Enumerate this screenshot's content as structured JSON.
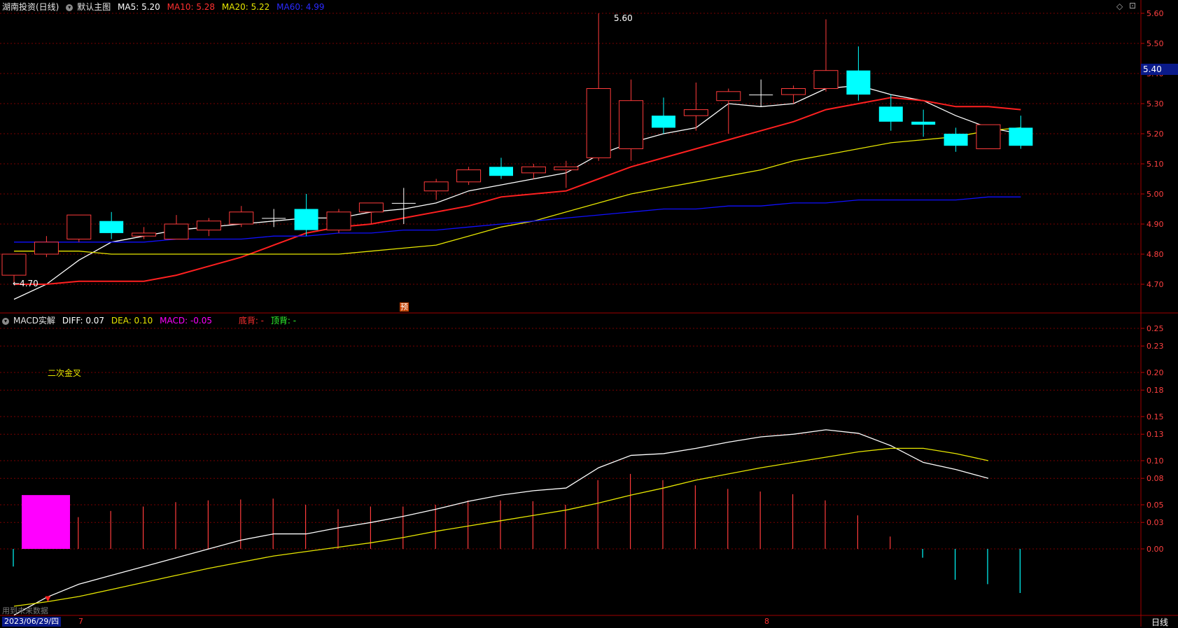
{
  "price_header": {
    "stock": "湖南投资(日线)",
    "main_label": "默认主图",
    "ma5": "MA5: 5.20",
    "ma10": "MA10: 5.28",
    "ma20": "MA20: 5.22",
    "ma60": "MA60: 4.99"
  },
  "macd_header": {
    "name": "MACD实解",
    "diff": "DIFF: 0.07",
    "dea": "DEA: 0.10",
    "macd": "MACD: -0.05",
    "bottom_div": "底背: -",
    "top_div": "顶背: -"
  },
  "annotations": {
    "high": "5.60",
    "low": "←4.70",
    "golden_cross": "二次金叉",
    "forecast": "预",
    "future_data": "用到未来数据"
  },
  "current_price": "5.40",
  "footer": {
    "date": "2023/06/29/四",
    "month7": "7",
    "month8": "8",
    "period": "日线"
  },
  "colors": {
    "up": "#ff3b3b",
    "down": "#00ffff",
    "ma5": "#ffffff",
    "ma10": "#ff2020",
    "ma20": "#e6e600",
    "ma60": "#1010ff",
    "macd_block": "#ff00ff",
    "grid": "#7a0000"
  },
  "chart_data": [
    {
      "type": "candlestick",
      "ylim": [
        4.62,
        5.62
      ],
      "yticks": [
        "5.60",
        "5.50",
        "5.40",
        "5.30",
        "5.20",
        "5.10",
        "5.00",
        "4.90",
        "4.80",
        "4.70"
      ],
      "candles": [
        {
          "o": 4.73,
          "h": 4.79,
          "l": 4.7,
          "c": 4.8
        },
        {
          "o": 4.8,
          "h": 4.86,
          "l": 4.79,
          "c": 4.84
        },
        {
          "o": 4.85,
          "h": 4.93,
          "l": 4.84,
          "c": 4.93
        },
        {
          "o": 4.91,
          "h": 4.94,
          "l": 4.85,
          "c": 4.87
        },
        {
          "o": 4.86,
          "h": 4.89,
          "l": 4.85,
          "c": 4.87
        },
        {
          "o": 4.85,
          "h": 4.93,
          "l": 4.85,
          "c": 4.9
        },
        {
          "o": 4.88,
          "h": 4.92,
          "l": 4.86,
          "c": 4.91
        },
        {
          "o": 4.9,
          "h": 4.96,
          "l": 4.89,
          "c": 4.94
        },
        {
          "o": 4.92,
          "h": 4.95,
          "l": 4.89,
          "c": 4.92
        },
        {
          "o": 4.95,
          "h": 5.0,
          "l": 4.86,
          "c": 4.88
        },
        {
          "o": 4.88,
          "h": 4.95,
          "l": 4.87,
          "c": 4.94
        },
        {
          "o": 4.94,
          "h": 4.97,
          "l": 4.9,
          "c": 4.97
        },
        {
          "o": 4.97,
          "h": 5.02,
          "l": 4.9,
          "c": 4.97
        },
        {
          "o": 5.01,
          "h": 5.05,
          "l": 4.98,
          "c": 5.04
        },
        {
          "o": 5.04,
          "h": 5.09,
          "l": 5.03,
          "c": 5.08
        },
        {
          "o": 5.09,
          "h": 5.12,
          "l": 5.05,
          "c": 5.06
        },
        {
          "o": 5.07,
          "h": 5.1,
          "l": 5.05,
          "c": 5.09
        },
        {
          "o": 5.08,
          "h": 5.11,
          "l": 5.02,
          "c": 5.09
        },
        {
          "o": 5.12,
          "h": 5.6,
          "l": 5.11,
          "c": 5.35
        },
        {
          "o": 5.15,
          "h": 5.38,
          "l": 5.11,
          "c": 5.31
        },
        {
          "o": 5.26,
          "h": 5.32,
          "l": 5.2,
          "c": 5.22
        },
        {
          "o": 5.26,
          "h": 5.37,
          "l": 5.21,
          "c": 5.28
        },
        {
          "o": 5.31,
          "h": 5.35,
          "l": 5.2,
          "c": 5.34
        },
        {
          "o": 5.33,
          "h": 5.38,
          "l": 5.29,
          "c": 5.33
        },
        {
          "o": 5.33,
          "h": 5.36,
          "l": 5.3,
          "c": 5.35
        },
        {
          "o": 5.35,
          "h": 5.58,
          "l": 5.34,
          "c": 5.41
        },
        {
          "o": 5.41,
          "h": 5.49,
          "l": 5.31,
          "c": 5.33
        },
        {
          "o": 5.29,
          "h": 5.33,
          "l": 5.21,
          "c": 5.24
        },
        {
          "o": 5.24,
          "h": 5.28,
          "l": 5.19,
          "c": 5.23
        },
        {
          "o": 5.2,
          "h": 5.22,
          "l": 5.14,
          "c": 5.16
        },
        {
          "o": 5.15,
          "h": 5.23,
          "l": 5.15,
          "c": 5.23
        },
        {
          "o": 5.22,
          "h": 5.26,
          "l": 5.15,
          "c": 5.16
        }
      ],
      "series": [
        {
          "name": "MA5",
          "values": [
            4.65,
            4.7,
            4.78,
            4.84,
            4.86,
            4.88,
            4.89,
            4.9,
            4.91,
            4.92,
            4.92,
            4.94,
            4.95,
            4.97,
            5.01,
            5.03,
            5.05,
            5.07,
            5.13,
            5.17,
            5.2,
            5.22,
            5.3,
            5.29,
            5.3,
            5.35,
            5.36,
            5.33,
            5.31,
            5.26,
            5.22,
            5.2
          ]
        },
        {
          "name": "MA10",
          "values": [
            4.7,
            4.7,
            4.71,
            4.71,
            4.71,
            4.73,
            4.76,
            4.79,
            4.83,
            4.87,
            4.89,
            4.9,
            4.92,
            4.94,
            4.96,
            4.99,
            5.0,
            5.01,
            5.05,
            5.09,
            5.12,
            5.15,
            5.18,
            5.21,
            5.24,
            5.28,
            5.3,
            5.32,
            5.31,
            5.29,
            5.29,
            5.28
          ]
        },
        {
          "name": "MA20",
          "values": [
            4.81,
            4.81,
            4.81,
            4.8,
            4.8,
            4.8,
            4.8,
            4.8,
            4.8,
            4.8,
            4.8,
            4.81,
            4.82,
            4.83,
            4.86,
            4.89,
            4.91,
            4.94,
            4.97,
            5.0,
            5.02,
            5.04,
            5.06,
            5.08,
            5.11,
            5.13,
            5.15,
            5.17,
            5.18,
            5.19,
            5.21,
            5.22
          ]
        },
        {
          "name": "MA60",
          "values": [
            4.84,
            4.84,
            4.84,
            4.84,
            4.84,
            4.85,
            4.85,
            4.85,
            4.86,
            4.86,
            4.87,
            4.87,
            4.88,
            4.88,
            4.89,
            4.9,
            4.91,
            4.92,
            4.93,
            4.94,
            4.95,
            4.95,
            4.96,
            4.96,
            4.97,
            4.97,
            4.98,
            4.98,
            4.98,
            4.98,
            4.99,
            4.99
          ]
        }
      ]
    },
    {
      "type": "macd",
      "ylim": [
        -0.1,
        0.27
      ],
      "yticks": [
        "0.25",
        "0.23",
        "0.20",
        "0.18",
        "0.15",
        "0.13",
        "0.10",
        "0.08",
        "0.05",
        "0.03",
        "0.00"
      ],
      "diff": [
        -0.075,
        -0.055,
        -0.04,
        -0.03,
        -0.02,
        -0.01,
        0.0,
        0.01,
        0.017,
        0.017,
        0.024,
        0.03,
        0.037,
        0.045,
        0.054,
        0.061,
        0.066,
        0.069,
        0.092,
        0.106,
        0.108,
        0.114,
        0.121,
        0.127,
        0.13,
        0.135,
        0.131,
        0.117,
        0.098,
        0.09,
        0.08
      ],
      "dea": [
        -0.065,
        -0.06,
        -0.054,
        -0.046,
        -0.038,
        -0.03,
        -0.022,
        -0.015,
        -0.008,
        -0.003,
        0.002,
        0.007,
        0.013,
        0.02,
        0.026,
        0.032,
        0.038,
        0.044,
        0.052,
        0.061,
        0.069,
        0.078,
        0.085,
        0.092,
        0.098,
        0.104,
        0.11,
        0.114,
        0.114,
        0.108,
        0.1
      ],
      "hist": [
        -0.02,
        0.0,
        0.036,
        0.043,
        0.048,
        0.053,
        0.055,
        0.056,
        0.057,
        0.05,
        0.045,
        0.048,
        0.048,
        0.05,
        0.055,
        0.055,
        0.054,
        0.05,
        0.078,
        0.085,
        0.078,
        0.072,
        0.068,
        0.065,
        0.062,
        0.055,
        0.038,
        0.014,
        -0.01,
        -0.035,
        -0.04,
        -0.05
      ],
      "block": 0.061
    }
  ]
}
